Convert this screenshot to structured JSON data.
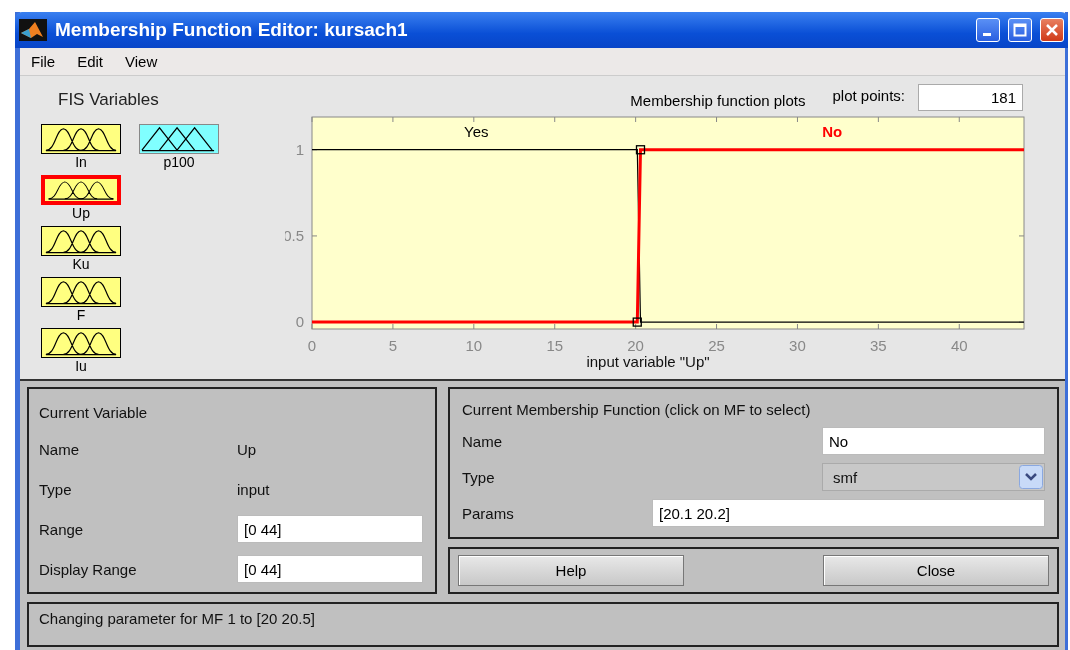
{
  "window": {
    "title": "Membership Function Editor: kursach1"
  },
  "menu": [
    "File",
    "Edit",
    "View"
  ],
  "fis_variables": {
    "heading": "FIS Variables",
    "inputs": [
      {
        "name": "In",
        "selected": false
      },
      {
        "name": "Up",
        "selected": true
      },
      {
        "name": "Ku",
        "selected": false
      },
      {
        "name": "F",
        "selected": false
      },
      {
        "name": "Iu",
        "selected": false
      }
    ],
    "outputs": [
      {
        "name": "p100",
        "selected": false
      }
    ]
  },
  "plot": {
    "title": "Membership function plots",
    "plot_points_label": "plot points:",
    "plot_points": "181",
    "chart_data": {
      "type": "line",
      "xlabel": "input variable \"Up\"",
      "x": [
        0,
        20.1,
        20.3,
        44
      ],
      "xlim": [
        0,
        44
      ],
      "ylim": [
        -0.04,
        1.19
      ],
      "xticks": [
        0,
        5,
        10,
        15,
        20,
        25,
        30,
        35,
        40
      ],
      "yticks": [
        0,
        0.5,
        1
      ],
      "series": [
        {
          "name": "Yes",
          "color": "#000000",
          "values": [
            1,
            1,
            0,
            0
          ]
        },
        {
          "name": "No",
          "color": "#ff0000",
          "values": [
            0,
            0,
            1,
            1
          ]
        }
      ]
    },
    "mf_states": [
      {
        "selected": false
      },
      {
        "selected": true
      }
    ]
  },
  "current_variable": {
    "heading": "Current Variable",
    "name_label": "Name",
    "name": "Up",
    "type_label": "Type",
    "type": "input",
    "range_label": "Range",
    "range": "[0 44]",
    "display_range_label": "Display Range",
    "display_range": "[0 44]"
  },
  "current_mf": {
    "heading": "Current Membership Function (click on MF to select)",
    "name_label": "Name",
    "name": "No",
    "type_label": "Type",
    "type": "smf",
    "params_label": "Params",
    "params": "[20.1 20.2]"
  },
  "buttons": [
    "Help",
    "Close"
  ],
  "status": "Changing parameter for MF 1 to  [20 20.5]"
}
